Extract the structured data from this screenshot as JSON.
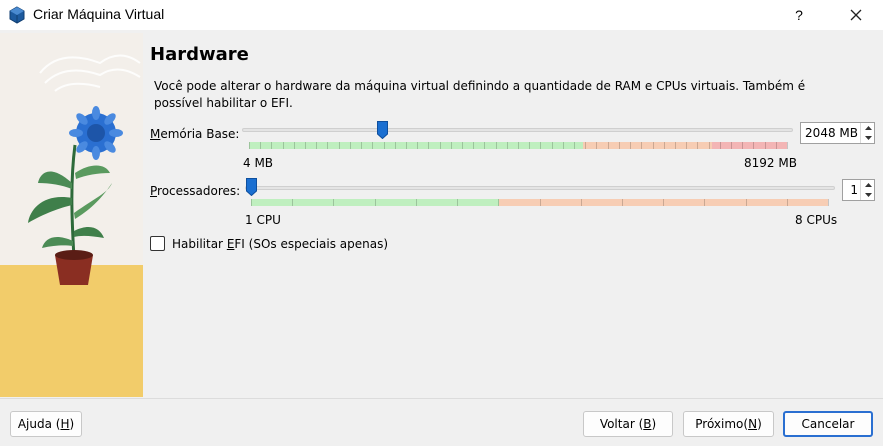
{
  "window": {
    "title": "Criar Máquina Virtual",
    "help": "?",
    "close": "✕"
  },
  "page": {
    "heading": "Hardware",
    "description": "Você pode alterar o hardware da máquina virtual definindo a quantidade de RAM e CPUs virtuais. Também é possível habilitar o EFI."
  },
  "memory": {
    "label_accel": "M",
    "label_rest": "emória Base:",
    "value": "2048 MB",
    "min_label": "4 MB",
    "max_label": "8192 MB",
    "current_mb": 2048,
    "min_mb": 4,
    "max_mb": 8192,
    "green_fraction": 0.62,
    "orange_fraction": 0.24,
    "red_fraction": 0.14
  },
  "processors": {
    "label_accel": "P",
    "label_rest": "rocessadores:",
    "value": "1",
    "min_label": "1 CPU",
    "max_label": "8 CPUs",
    "current": 1,
    "min": 1,
    "max": 8,
    "green_fraction": 0.43,
    "orange_fraction": 0.57
  },
  "efi": {
    "label_before": "Habilitar ",
    "label_accel": "E",
    "label_after": "FI (SOs especiais apenas)",
    "checked": false
  },
  "buttons": {
    "help": {
      "before": "Ajuda (",
      "accel": "H",
      "after": ")"
    },
    "back": {
      "before": "Voltar (",
      "accel": "B",
      "after": ")"
    },
    "next": {
      "before": "Próximo(",
      "accel": "N",
      "after": ")"
    },
    "cancel": {
      "label": "Cancelar"
    }
  },
  "colors": {
    "slider_handle": "#1a6fd1",
    "scale_green": "#bfefbf",
    "scale_orange": "#f7cdb4",
    "scale_red": "#f3b5b5",
    "primary_border": "#2a6fd1"
  },
  "icons": {
    "app": "virtualbox-icon",
    "help": "help-icon",
    "close": "close-icon",
    "spin_up": "chevron-up-icon",
    "spin_down": "chevron-down-icon"
  }
}
